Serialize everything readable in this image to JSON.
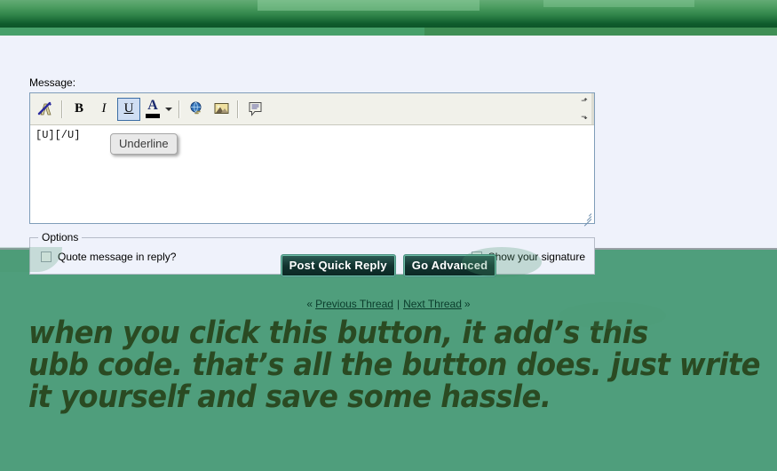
{
  "colors": {
    "page_green": "#4f9e7c",
    "banner_dark_green": "#0d5529",
    "panel_bg": "#eff2fb",
    "caption_green": "#2a4a22",
    "button_dark": "#123430",
    "button_border": "#6fbfa8",
    "active_toolbar_button": "#cfdef3"
  },
  "form": {
    "message_label": "Message:",
    "textarea_value": "[U][/U]",
    "textarea_placeholder": ""
  },
  "tooltip": {
    "text": "Underline"
  },
  "toolbar": {
    "buttons": [
      {
        "name": "remove-formatting-icon",
        "label": "",
        "icon": "remove-format-icon",
        "active": false
      },
      {
        "name": "bold-button",
        "label": "B",
        "icon": "bold-icon",
        "active": false
      },
      {
        "name": "italic-button",
        "label": "I",
        "icon": "italic-icon",
        "active": false
      },
      {
        "name": "underline-button",
        "label": "U",
        "icon": "underline-icon",
        "active": true
      },
      {
        "name": "font-color-button",
        "label": "A",
        "icon": "font-color-icon",
        "active": false
      },
      {
        "name": "insert-link-button",
        "label": "",
        "icon": "globe-link-icon",
        "active": false
      },
      {
        "name": "insert-image-button",
        "label": "",
        "icon": "image-icon",
        "active": false
      },
      {
        "name": "insert-quote-button",
        "label": "",
        "icon": "quote-icon",
        "active": false
      }
    ],
    "scroll_up": "⬏",
    "scroll_down": "⬎"
  },
  "options": {
    "legend": "Options",
    "items": [
      {
        "label": "Quote message in reply?",
        "checked": false,
        "name": "quote-message-checkbox"
      },
      {
        "label": "Show your signature",
        "checked": true,
        "name": "show-signature-checkbox"
      }
    ]
  },
  "actions": {
    "post_quick_reply": "Post Quick Reply",
    "go_advanced": "Go Advanced"
  },
  "thread_nav": {
    "prev_chevron": "«",
    "previous": "Previous Thread",
    "separator": "|",
    "next": "Next Thread",
    "next_chevron": "»"
  },
  "caption": {
    "line1": "when you click this button, it add’s this",
    "line2": "ubb code. that’s all the button does. just write",
    "line3": "it yourself and save some hassle."
  }
}
